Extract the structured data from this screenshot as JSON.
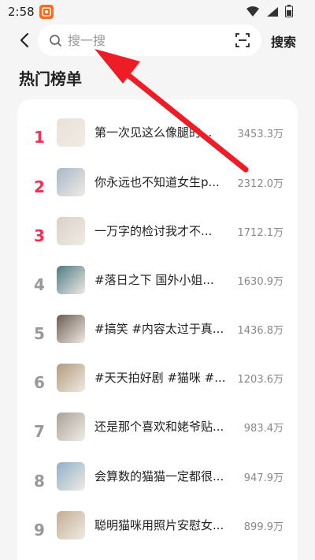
{
  "status_bar": {
    "time": "2:58"
  },
  "search": {
    "placeholder": "搜一搜",
    "search_button": "搜索"
  },
  "section_title": "热门榜单",
  "colors": {
    "accent": "#fe2c55",
    "annotation_arrow": "#ee1c24"
  },
  "items": [
    {
      "rank": "1",
      "title": "第一次见这么像腿的...",
      "count": "3453.3万",
      "top": true,
      "thumb": "#e8e2d8"
    },
    {
      "rank": "2",
      "title": "你永远也不知道女生p...",
      "count": "2312.0万",
      "top": true,
      "thumb": "#a7b8c9"
    },
    {
      "rank": "3",
      "title": "一万字的检讨我才不...",
      "count": "1712.1万",
      "top": true,
      "thumb": "#d9d1c8"
    },
    {
      "rank": "4",
      "title": "#落日之下 国外小姐...",
      "count": "1630.9万",
      "top": false,
      "thumb": "#4f7a84"
    },
    {
      "rank": "5",
      "title": "#搞笑 #内容太过于真...",
      "count": "1436.8万",
      "top": false,
      "thumb": "#6d5c52"
    },
    {
      "rank": "6",
      "title": "#天天拍好剧 #猫咪 #...",
      "count": "1203.6万",
      "top": false,
      "thumb": "#b29a7d"
    },
    {
      "rank": "7",
      "title": "还是那个喜欢和姥爷贴...",
      "count": "983.4万",
      "top": false,
      "thumb": "#a9a29a"
    },
    {
      "rank": "8",
      "title": "会算数的猫猫一定都很...",
      "count": "947.9万",
      "top": false,
      "thumb": "#8fb0c8"
    },
    {
      "rank": "9",
      "title": "聪明猫咪用照片安慰女...",
      "count": "899.9万",
      "top": false,
      "thumb": "#c4ad93"
    }
  ]
}
